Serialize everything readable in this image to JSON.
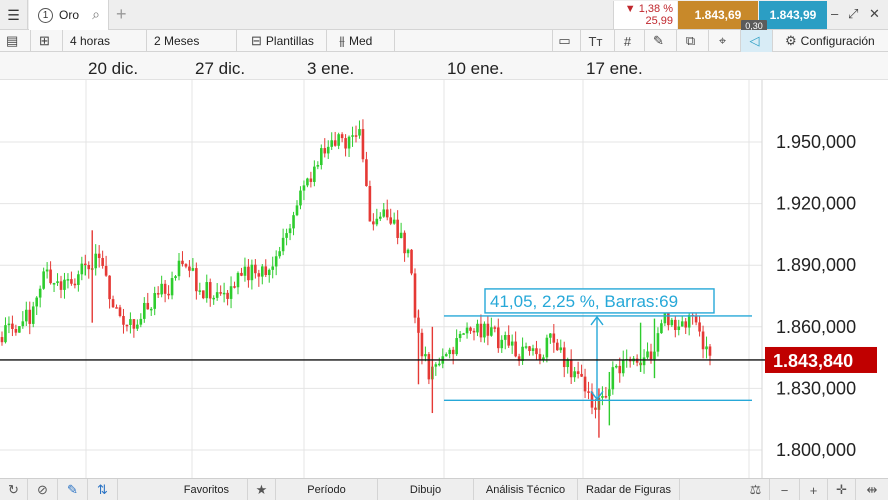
{
  "tabbar": {
    "menu_icon": "hamburger-icon",
    "tab_number": "1",
    "tab_label": "Oro",
    "add_tab": "+",
    "change_pct": "▼ 1,38 %",
    "change_abs": "25,99",
    "sell_price": "1.843,69",
    "buy_price": "1.843,99",
    "spread": "0,30"
  },
  "toolbar": {
    "interval": "4 horas",
    "range": "2 Meses",
    "templates": "Plantillas",
    "chart_style": "Med",
    "config": "Configuración"
  },
  "dates": [
    "20 dic.",
    "27 dic.",
    "3 ene.",
    "10 ene.",
    "17 ene."
  ],
  "chart_data": {
    "type": "candlestick",
    "instrument": "Oro",
    "ylim": [
      1785,
      1980
    ],
    "y_ticks": [
      "1.950,000",
      "1.920,000",
      "1.890,000",
      "1.860,000",
      "1.830,000",
      "1.800,000"
    ],
    "y_tick_values": [
      1950,
      1920,
      1890,
      1860,
      1830,
      1800
    ],
    "current_price": 1843.84,
    "current_price_label": "1.843,840",
    "measurement": {
      "label": "41,05, 2,25 %, Barras:69",
      "upper": 1865.3,
      "lower": 1824.2
    },
    "up_color": "#2ecc2e",
    "down_color": "#e53935"
  },
  "colors": {
    "measure": "#26a8d8",
    "current_badge": "#c00000",
    "sell": "#c8892a",
    "buy": "#2b9ec4"
  },
  "bottombar": {
    "favorites": "Favoritos",
    "period": "Período",
    "drawing": "Dibujo",
    "technical": "Análisis Técnico",
    "patterns": "Radar de Figuras"
  }
}
